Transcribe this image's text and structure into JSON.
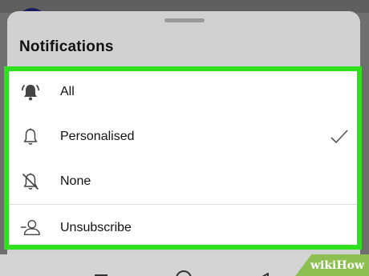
{
  "sheet": {
    "title": "Notifications"
  },
  "options": [
    {
      "label": "All",
      "icon": "bell-ringing-filled-icon",
      "selected": false
    },
    {
      "label": "Personalised",
      "icon": "bell-outline-icon",
      "selected": true
    },
    {
      "label": "None",
      "icon": "bell-off-icon",
      "selected": false
    },
    {
      "label": "Unsubscribe",
      "icon": "unsubscribe-person-icon",
      "selected": false
    }
  ],
  "colors": {
    "highlight": "#2fe01d",
    "icon": "#444444",
    "check": "#555555",
    "watermark_bg": "#8dbf52"
  },
  "watermark": {
    "part1": "wiki",
    "part2": "How"
  }
}
